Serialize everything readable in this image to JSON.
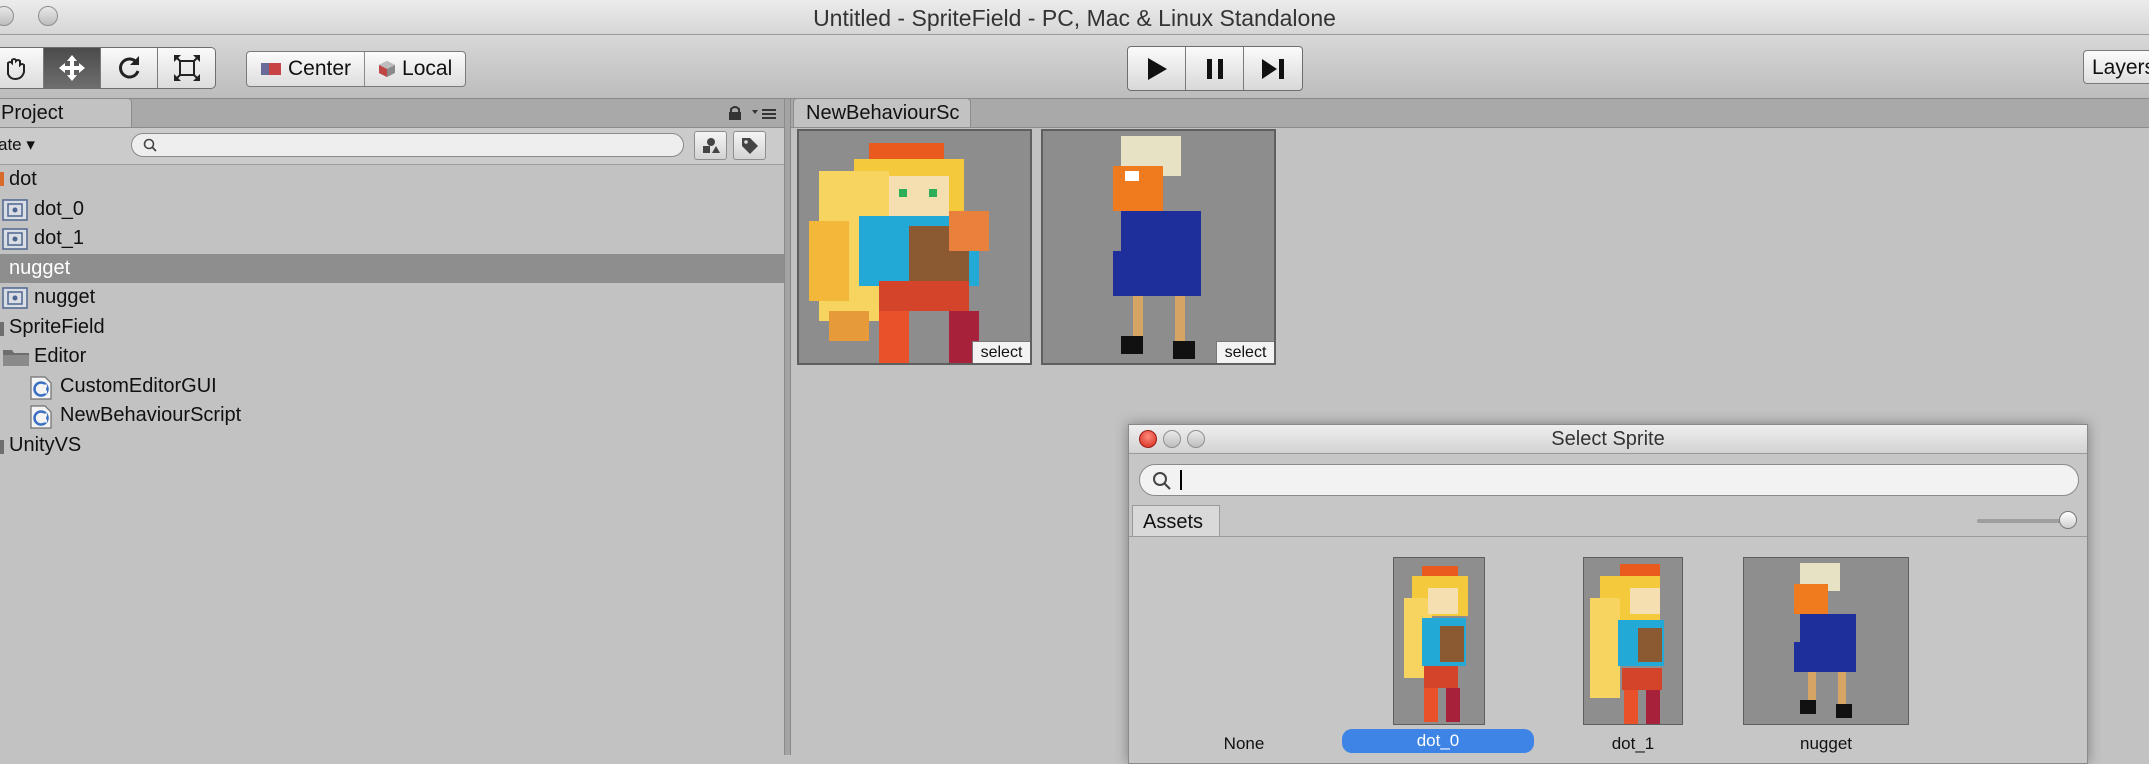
{
  "window": {
    "title": "Untitled - SpriteField - PC, Mac & Linux Standalone"
  },
  "toolbar": {
    "tools": [
      "hand-icon",
      "move-icon",
      "rotate-icon",
      "scale-icon"
    ],
    "pivot": {
      "center_label": "Center",
      "local_label": "Local"
    },
    "playback": [
      "play-icon",
      "pause-icon",
      "step-icon"
    ],
    "layers_label": "Layers"
  },
  "project": {
    "tab_label": "Project",
    "create_label": "ate ▾",
    "search_placeholder": "",
    "items": [
      {
        "label": "dot",
        "indent": 0,
        "icon": "sprite-sheet-icon"
      },
      {
        "label": "dot_0",
        "indent": 1,
        "icon": "sprite-icon"
      },
      {
        "label": "dot_1",
        "indent": 1,
        "icon": "sprite-icon"
      },
      {
        "label": "nugget",
        "indent": 0,
        "icon": "sprite-sheet-icon",
        "selected": true
      },
      {
        "label": "nugget",
        "indent": 1,
        "icon": "sprite-icon"
      },
      {
        "label": "SpriteField",
        "indent": 0,
        "icon": "folder-icon"
      },
      {
        "label": "Editor",
        "indent": 1,
        "icon": "folder-icon"
      },
      {
        "label": "CustomEditorGUI",
        "indent": 2,
        "icon": "csharp-script-icon"
      },
      {
        "label": "NewBehaviourScript",
        "indent": 2,
        "icon": "csharp-script-icon"
      },
      {
        "label": "UnityVS",
        "indent": 0,
        "icon": "folder-icon"
      }
    ]
  },
  "inspector": {
    "tab_label": "NewBehaviourSc",
    "slots": [
      {
        "sprite": "dot_0",
        "button_label": "select"
      },
      {
        "sprite": "nugget",
        "button_label": "select"
      }
    ]
  },
  "select_sprite_dialog": {
    "title": "Select Sprite",
    "search_value": "",
    "assets_tab_label": "Assets",
    "zoom_level": 1.0,
    "items": [
      {
        "label": "None",
        "selected": false
      },
      {
        "label": "dot_0",
        "selected": true
      },
      {
        "label": "dot_1",
        "selected": false
      },
      {
        "label": "nugget",
        "selected": false
      }
    ]
  },
  "colors": {
    "selection_blue": "#3d84e6",
    "tree_selected": "#8e8e8e",
    "panel_bg": "#c2c2c2",
    "close_red": "#d3261c"
  }
}
